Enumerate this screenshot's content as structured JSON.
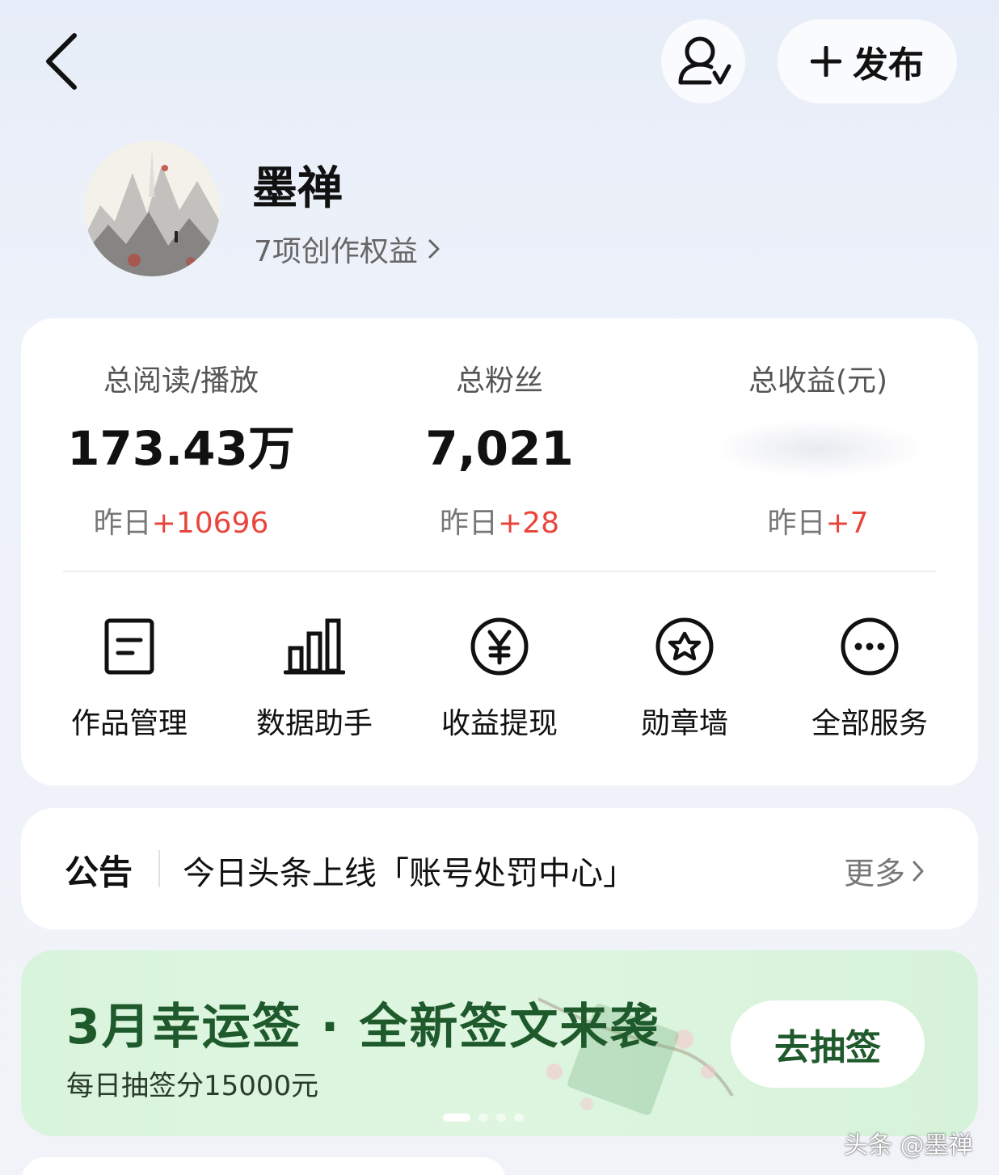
{
  "header": {
    "publish_label": "发布"
  },
  "profile": {
    "name": "墨禅",
    "rights_label": "7项创作权益"
  },
  "stats": [
    {
      "label": "总阅读/播放",
      "value": "173.43万",
      "delta_prefix": "昨日",
      "delta": "+10696"
    },
    {
      "label": "总粉丝",
      "value": "7,021",
      "delta_prefix": "昨日",
      "delta": "+28"
    },
    {
      "label": "总收益(元)",
      "value": "",
      "delta_prefix": "昨日",
      "delta": "+7"
    }
  ],
  "services": [
    {
      "label": "作品管理",
      "icon": "document-icon"
    },
    {
      "label": "数据助手",
      "icon": "bar-chart-icon"
    },
    {
      "label": "收益提现",
      "icon": "yen-icon"
    },
    {
      "label": "勋章墙",
      "icon": "badge-star-icon"
    },
    {
      "label": "全部服务",
      "icon": "more-icon"
    }
  ],
  "notice": {
    "title": "公告",
    "text": "今日头条上线「账号处罚中心」",
    "more": "更多"
  },
  "banner": {
    "title": "3月幸运签 · 全新签文来袭",
    "subtitle": "每日抽签分15000元",
    "button": "去抽签",
    "slide_count": 4,
    "active_slide": 1
  },
  "watermark": "头条 @墨禅",
  "colors": {
    "accent_red": "#e8453c",
    "banner_green": "#1f5a2c",
    "banner_bg": "#d9f4dc"
  }
}
